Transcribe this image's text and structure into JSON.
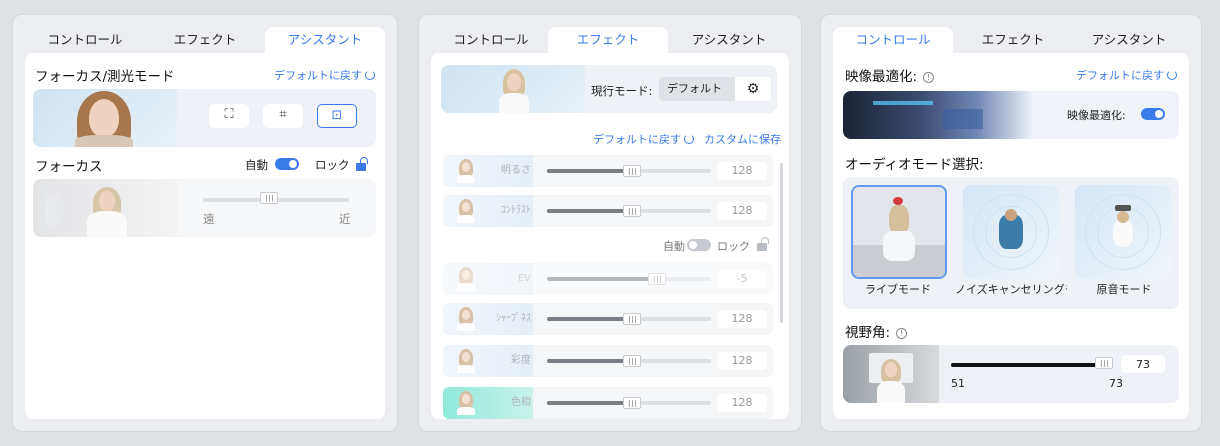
{
  "tabs": [
    "コントロール",
    "エフェクト",
    "アシスタント"
  ],
  "panel1": {
    "active_tab": 2,
    "focus_metering_title": "フォーカス/測光モード",
    "reset_label": "デフォルトに戻す",
    "focus_title": "フォーカス",
    "auto_label": "自動",
    "lock_label": "ロック",
    "slider_left_label": "遠",
    "slider_right_label": "近",
    "focus_slider_value": 0.45,
    "mode_buttons": [
      "face-focus-icon",
      "frame-focus-icon",
      "center-focus-icon"
    ],
    "selected_mode_index": 2
  },
  "panel2": {
    "active_tab": 1,
    "current_mode_label": "現行モード:",
    "current_mode_value": "デフォルト",
    "reset_label": "デフォルトに戻す",
    "save_custom_label": "カスタムに保存",
    "auto_label": "自動",
    "lock_label": "ロック",
    "rows": [
      {
        "name": "明るさ",
        "value": "128",
        "fill": 0.5
      },
      {
        "name": "ｺﾝﾄﾗｽﾄ",
        "value": "128",
        "fill": 0.5
      },
      {
        "name": "EV",
        "value": "-5",
        "fill": 0.65
      },
      {
        "name": "ｼｬｰﾌﾟﾈｽ",
        "value": "128",
        "fill": 0.5
      },
      {
        "name": "彩度",
        "value": "128",
        "fill": 0.5
      },
      {
        "name": "色相",
        "value": "128",
        "fill": 0.5
      }
    ]
  },
  "panel3": {
    "active_tab": 0,
    "video_opt_title": "映像最適化:",
    "reset_label": "デフォルトに戻す",
    "video_opt_toggle_label": "映像最適化:",
    "audio_title": "オーディオモード選択:",
    "audio_modes": [
      "ライブモード",
      "ノイズキャンセリングモード",
      "原音モード"
    ],
    "selected_audio_mode": 0,
    "fov_title": "視野角:",
    "fov_value": "73",
    "fov_min": "51",
    "fov_max": "73",
    "fov_fill": 1.0
  },
  "colors": {
    "accent": "#3a7bea",
    "panel_bg": "#eceef1",
    "card_bg": "#ffffff"
  }
}
